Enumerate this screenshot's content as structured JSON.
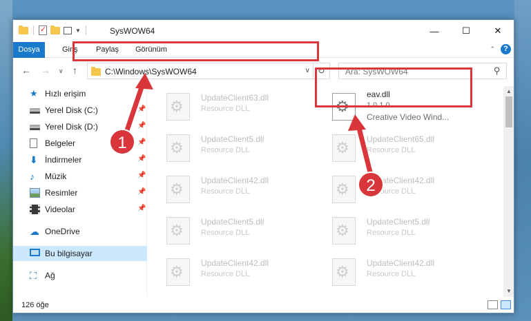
{
  "window": {
    "title": "SysWOW64"
  },
  "window_controls": {
    "minimize": "—",
    "maximize": "☐",
    "close": "✕"
  },
  "ribbon": {
    "tabs": [
      "Dosya",
      "Giriş",
      "Paylaş",
      "Görünüm"
    ]
  },
  "address_bar": {
    "path": "C:\\Windows\\SysWOW64"
  },
  "search": {
    "placeholder": "Ara: SysWOW64"
  },
  "sidebar": {
    "items": [
      {
        "label": "Hızlı erişim",
        "icon": "star-icon"
      },
      {
        "label": "Yerel Disk (C:)",
        "icon": "drive-icon",
        "pinned": true
      },
      {
        "label": "Yerel Disk (D:)",
        "icon": "drive-icon",
        "pinned": true
      },
      {
        "label": "Belgeler",
        "icon": "document-icon",
        "pinned": true
      },
      {
        "label": "İndirmeler",
        "icon": "download-icon",
        "pinned": true
      },
      {
        "label": "Müzik",
        "icon": "music-icon",
        "pinned": true
      },
      {
        "label": "Resimler",
        "icon": "pictures-icon",
        "pinned": true
      },
      {
        "label": "Videolar",
        "icon": "videos-icon",
        "pinned": true
      },
      {
        "label": "OneDrive",
        "icon": "cloud-icon"
      },
      {
        "label": "Bu bilgisayar",
        "icon": "computer-icon",
        "selected": true
      },
      {
        "label": "Ağ",
        "icon": "network-icon"
      }
    ]
  },
  "files": [
    {
      "name": "UpdateClient63.dll",
      "type": "Resource DLL"
    },
    {
      "name": "eav.dll",
      "version": "1.0.1.0",
      "description": "Creative Video Wind..."
    },
    {
      "name": "UpdateClient5.dll",
      "type": "Resource DLL"
    },
    {
      "name": "UpdateClient65.dll",
      "type": "Resource DLL"
    },
    {
      "name": "UpdateClient42.dll",
      "type": "Resource DLL"
    },
    {
      "name": "UpdateClient42.dll",
      "type": "Resource DLL"
    },
    {
      "name": "UpdateClient5.dll",
      "type": "Resource DLL"
    },
    {
      "name": "UpdateClient5.dll",
      "type": "Resource DLL"
    },
    {
      "name": "UpdateClient42.dll",
      "type": "Resource DLL"
    },
    {
      "name": "UpdateClient42.dll",
      "type": "Resource DLL"
    }
  ],
  "status": {
    "item_count": "126 öğe"
  },
  "annotations": {
    "step1": "1",
    "step2": "2"
  },
  "colors": {
    "annotation_red": "#d8363b",
    "accent": "#1979ca"
  }
}
